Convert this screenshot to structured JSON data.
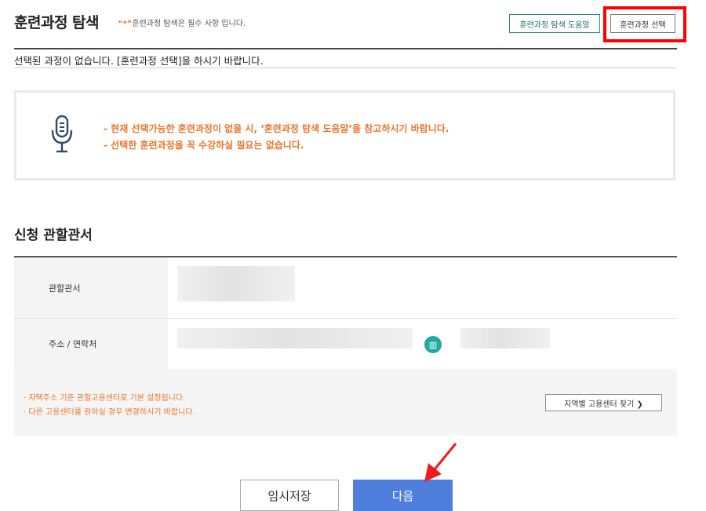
{
  "course_search": {
    "title": "훈련과정 탐색",
    "required_star": "“*”",
    "required_note": "훈련과정 탐색은 필수 사항 입니다.",
    "help_button": "훈련과정 탐색 도움말",
    "select_button": "훈련과정 선택",
    "no_course_message": "선택된 과정이 없습니다. [훈련과정 선택]을 하시기 바랍니다."
  },
  "info_box": {
    "lines": [
      "- 현재 선택가능한 훈련과정이 없을 시, ‘훈련과정 탐색 도움말’을 참고하시기 바랍니다.",
      "- 선택한 훈련과정을 꼭 수강하실 필요는 없습니다."
    ]
  },
  "jurisdiction": {
    "title": "신청 관할관서",
    "office_label": "관할관서",
    "address_label": "주소 / 연락처",
    "notices": [
      "· 자택주소 기준 관할고용센터로 기본 설정됩니다.",
      "· 다른 고용센터를 원하실 경우 변경하시기 바랍니다."
    ],
    "region_button": "지역별 고용센터 찾기 ❯"
  },
  "footer": {
    "save_button": "임시저장",
    "next_button": "다음"
  },
  "colors": {
    "accent_orange": "#e8762b",
    "primary_blue": "#4f7fdc",
    "teal": "#1fa99f",
    "annotation_red": "#ff0000"
  }
}
